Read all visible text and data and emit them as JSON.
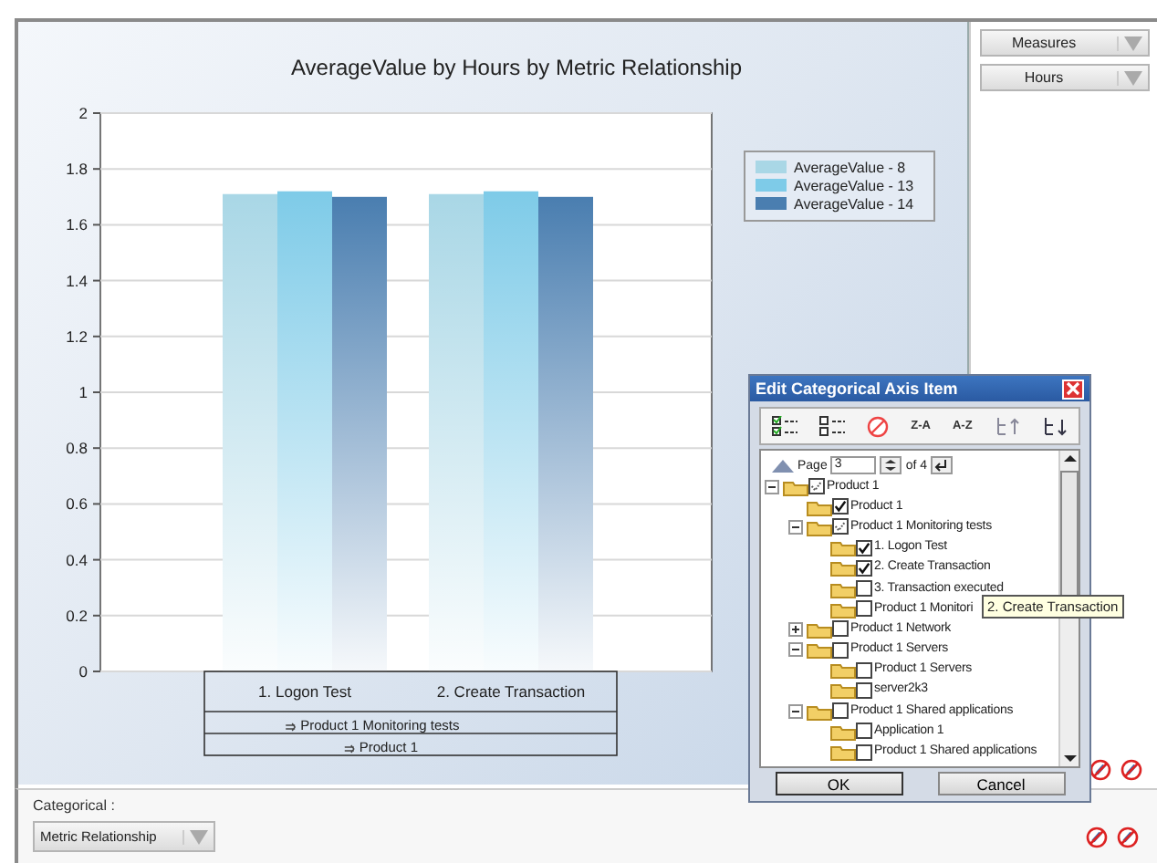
{
  "chart": {
    "chart_data": {
      "type": "bar",
      "title": "AverageValue by Hours by Metric Relationship",
      "categories": [
        "1. Logon Test",
        "2. Create Transaction"
      ],
      "series": [
        {
          "name": "AverageValue - 8",
          "color": "#a9d7e6",
          "values": [
            1.71,
            1.71
          ]
        },
        {
          "name": "AverageValue - 13",
          "color": "#7ecbe8",
          "values": [
            1.72,
            1.72
          ]
        },
        {
          "name": "AverageValue - 14",
          "color": "#4a7eb0",
          "values": [
            1.7,
            1.7
          ]
        }
      ],
      "grid": true,
      "legend": true,
      "ylim": [
        0,
        2
      ],
      "yticks": [
        0,
        0.2,
        0.4,
        0.6,
        0.8,
        {
          "value": 1,
          "label": "1"
        },
        1.2,
        1.4,
        1.6,
        1.8,
        {
          "value": 2,
          "label": "2"
        }
      ]
    },
    "group_labels": [
      "Product 1 Monitoring tests",
      "Product 1"
    ]
  },
  "axis_fields": [
    "Measures",
    "Hours"
  ],
  "categorical": {
    "label": "Categorical :",
    "field": "Metric Relationship"
  },
  "dialog": {
    "title": "Edit Categorical Axis Item",
    "sort_buttons": [
      "Z-A",
      "A-Z"
    ],
    "page_label": "Page",
    "page": "3",
    "page_of": "of 4",
    "tree": [
      {
        "label": "Product 1",
        "checked": true,
        "mixed": true,
        "expanded": true,
        "children": [
          {
            "label": "Product 1",
            "checked": true,
            "mixed": false
          },
          {
            "label": "Product 1 Monitoring tests",
            "checked": true,
            "mixed": true,
            "expanded": true,
            "children": [
              {
                "label": "1. Logon Test",
                "checked": true,
                "mixed": false
              },
              {
                "label": "2. Create Transaction",
                "checked": true,
                "mixed": false
              },
              {
                "label": "3. Transaction executed",
                "checked": false,
                "mixed": false
              },
              {
                "label": "Product 1 Monitori",
                "checked": false,
                "mixed": false
              }
            ]
          },
          {
            "label": "Product 1 Network",
            "checked": false,
            "mixed": false,
            "expanded": false
          },
          {
            "label": "Product 1 Servers",
            "checked": false,
            "mixed": false,
            "expanded": true,
            "children": [
              {
                "label": "Product 1 Servers",
                "checked": false,
                "mixed": false
              },
              {
                "label": "server2k3",
                "checked": false,
                "mixed": false
              }
            ]
          },
          {
            "label": "Product 1 Shared applications",
            "checked": false,
            "mixed": false,
            "expanded": true,
            "children": [
              {
                "label": "Application 1",
                "checked": false,
                "mixed": false
              },
              {
                "label": "Product 1 Shared applications",
                "checked": false,
                "mixed": false
              }
            ]
          }
        ]
      }
    ],
    "buttons": [
      "OK",
      "Cancel"
    ],
    "tooltip": "2. Create Transaction"
  }
}
